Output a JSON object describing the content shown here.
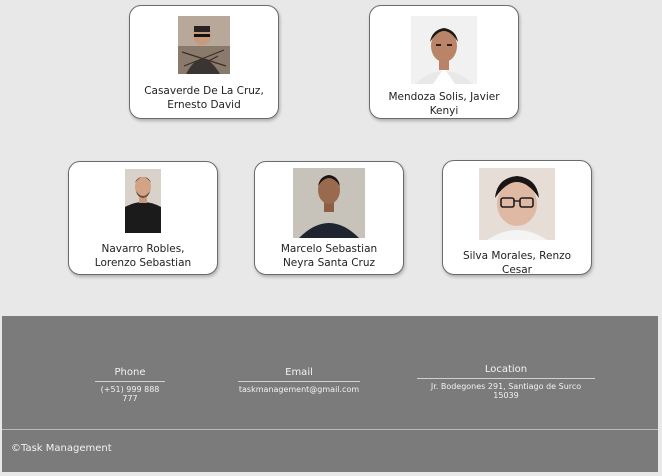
{
  "team": [
    {
      "name_line1": "Casaverde De La Cruz,",
      "name_line2": "Ernesto David",
      "photo": "person-photo"
    },
    {
      "name_line1": "Mendoza Solis, Javier Kenyi",
      "name_line2": "",
      "photo": "person-photo"
    },
    {
      "name_line1": "Navarro Robles,",
      "name_line2": "Lorenzo Sebastian",
      "photo": "person-photo"
    },
    {
      "name_line1": "Marcelo Sebastian",
      "name_line2": "Neyra Santa Cruz",
      "photo": "person-photo"
    },
    {
      "name_line1": "Silva Morales, Renzo Cesar",
      "name_line2": "",
      "photo": "person-photo"
    }
  ],
  "footer": {
    "phone": {
      "title": "Phone",
      "value": "(+51) 999 888 777"
    },
    "email": {
      "title": "Email",
      "value": "taskmanagement@gmail.com"
    },
    "location": {
      "title": "Location",
      "value": "Jr. Bodegones 291, Santiago de Surco 15039"
    },
    "copyright": "©Task Management"
  },
  "colors": {
    "page_background": "#e9e8e9",
    "footer_background": "#7b7b7b",
    "card_background": "#ffffff"
  }
}
